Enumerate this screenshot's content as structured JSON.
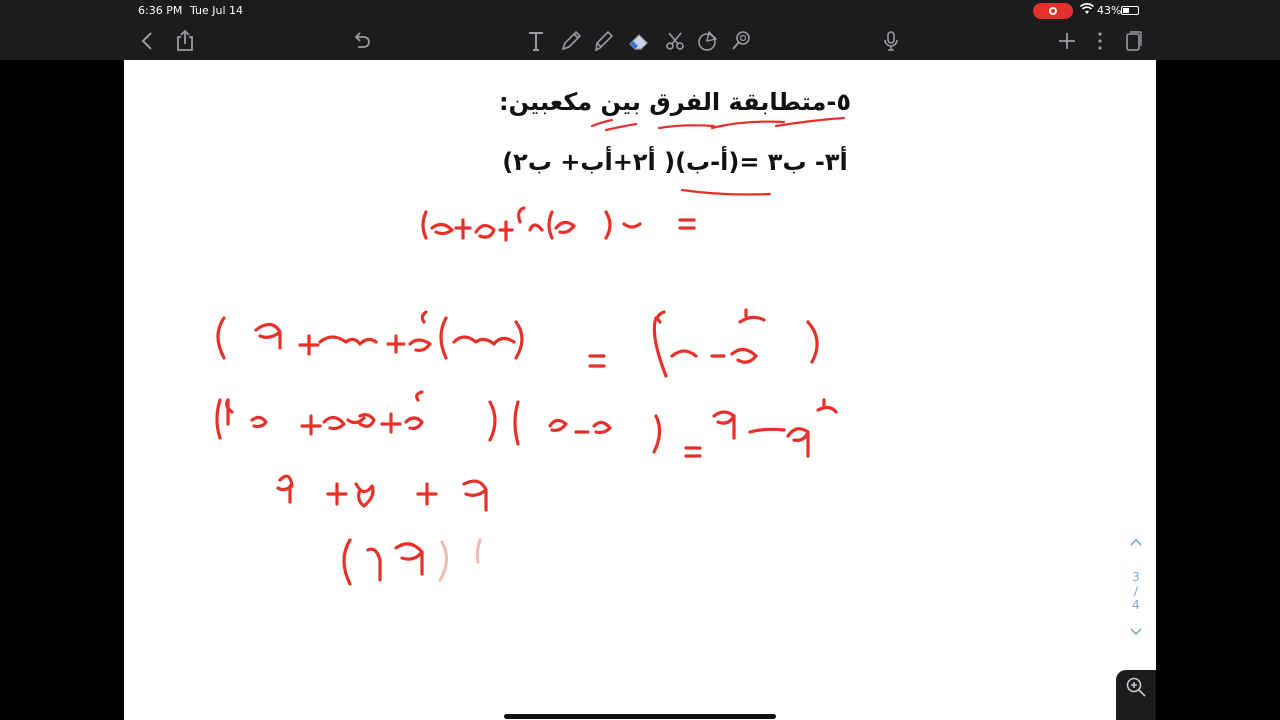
{
  "status": {
    "time": "6:36 PM",
    "date": "Tue Jul 14",
    "battery": "43%",
    "battery_level": 0.43
  },
  "toolbar": {
    "left_icons": [
      "back-icon",
      "share-icon",
      "undo-icon"
    ],
    "tools": [
      "text-tool-icon",
      "pen-icon",
      "highlighter-icon",
      "eraser-icon",
      "lasso-icon",
      "shapes-icon",
      "image-icon"
    ],
    "right_icons": [
      "mic-icon",
      "add-icon",
      "more-icon",
      "pages-icon"
    ]
  },
  "note": {
    "heading": "٥-متطابقة الفرق بين مكعبين:",
    "formula": "أ٣- ب٣ =(أ-ب)( أ٢+أب+ ب٢)"
  },
  "page_nav": {
    "current": "3",
    "separator": "/",
    "total": "4"
  },
  "colors": {
    "ink_red": "#e8302a",
    "underline_red": "#e8302a",
    "bar": "#1c1c1e",
    "nav_blue": "#7ea7d8"
  }
}
